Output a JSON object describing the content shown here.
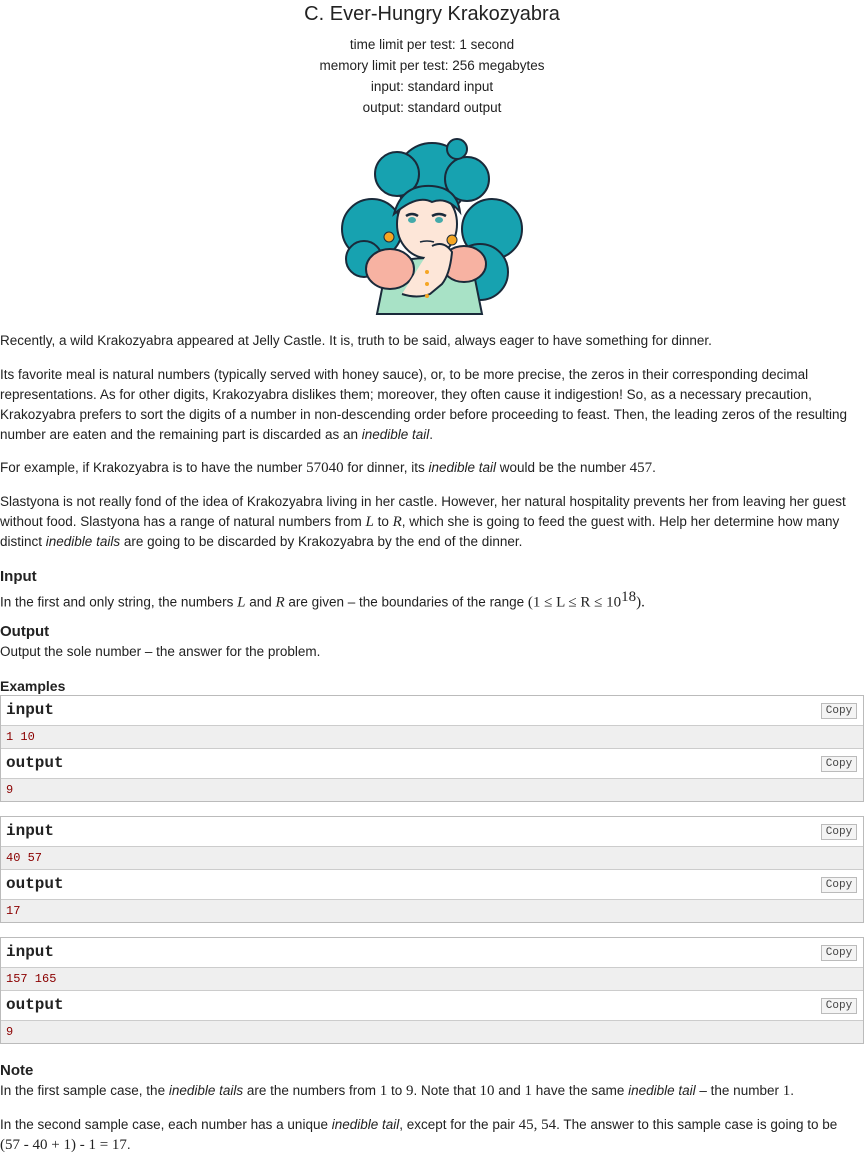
{
  "problem": {
    "title": "C. Ever-Hungry Krakozyabra",
    "time_limit": "time limit per test: 1 second",
    "memory_limit": "memory limit per test: 256 megabytes",
    "input_file": "input: standard input",
    "output_file": "output: standard output"
  },
  "statement": {
    "p1": "Recently, a wild Krakozyabra appeared at Jelly Castle. It is, truth to be said, always eager to have something for dinner.",
    "p2": "Its favorite meal is natural numbers (typically served with honey sauce), or, to be more precise, the zeros in their corresponding decimal representations. As for other digits, Krakozyabra dislikes them; moreover, they often cause it indigestion! So, as a necessary precaution, Krakozyabra prefers to sort the digits of a number in non-descending order before proceeding to feast. Then, the leading zeros of the resulting number are eaten and the remaining part is discarded as an ",
    "p2_em": "inedible tail",
    "p2_end": ".",
    "p3_a": "For example, if Krakozyabra is to have the number ",
    "p3_n1": "57040",
    "p3_b": " for dinner, its ",
    "p3_em": "inedible tail",
    "p3_c": " would be the number ",
    "p3_n2": "457",
    "p3_d": ".",
    "p4_a": "Slastyona is not really fond of the idea of Krakozyabra living in her castle. However, her natural hospitality prevents her from leaving her guest without food. Slastyona has a range of natural numbers from ",
    "p4_L": "L",
    "p4_to": " to ",
    "p4_R": "R",
    "p4_b": ", which she is going to feed the guest with. Help her determine how many distinct ",
    "p4_em": "inedible tails",
    "p4_c": " are going to be discarded by Krakozyabra by the end of the dinner."
  },
  "input_section": {
    "heading": "Input",
    "text_a": "In the first and only string, the numbers ",
    "L": "L",
    "and": " and ",
    "R": "R",
    "text_b": " are given – the boundaries of the range ",
    "range": "(1 ≤ L ≤ R ≤ 10",
    "exp": "18",
    "range_end": ").",
    "dot": ""
  },
  "output_section": {
    "heading": "Output",
    "text": "Output the sole number – the answer for the problem."
  },
  "examples": {
    "heading": "Examples",
    "copy_label": "Copy",
    "input_label": "input",
    "output_label": "output",
    "tests": [
      {
        "input": "1 10",
        "output": "9"
      },
      {
        "input": "40 57",
        "output": "17"
      },
      {
        "input": "157 165",
        "output": "9"
      }
    ]
  },
  "note": {
    "heading": "Note",
    "n1_a": "In the first sample case, the ",
    "n1_em": "inedible tails",
    "n1_b": " are the numbers from ",
    "n1_1": "1",
    "n1_to": " to ",
    "n1_9": "9",
    "n1_c": ". Note that ",
    "n1_10": "10",
    "n1_and": " and ",
    "n1_1b": "1",
    "n1_d": " have the same ",
    "n1_em2": "inedible tail",
    "n1_e": " – the number ",
    "n1_1c": "1",
    "n1_f": ".",
    "n2_a": "In the second sample case, each number has a unique ",
    "n2_em": "inedible tail",
    "n2_b": ", except for the pair ",
    "n2_pair": "45, 54",
    "n2_c": ". The answer to this sample case is going to be ",
    "n2_expr": "(57 - 40 + 1) - 1 = 17",
    "n2_d": "."
  }
}
